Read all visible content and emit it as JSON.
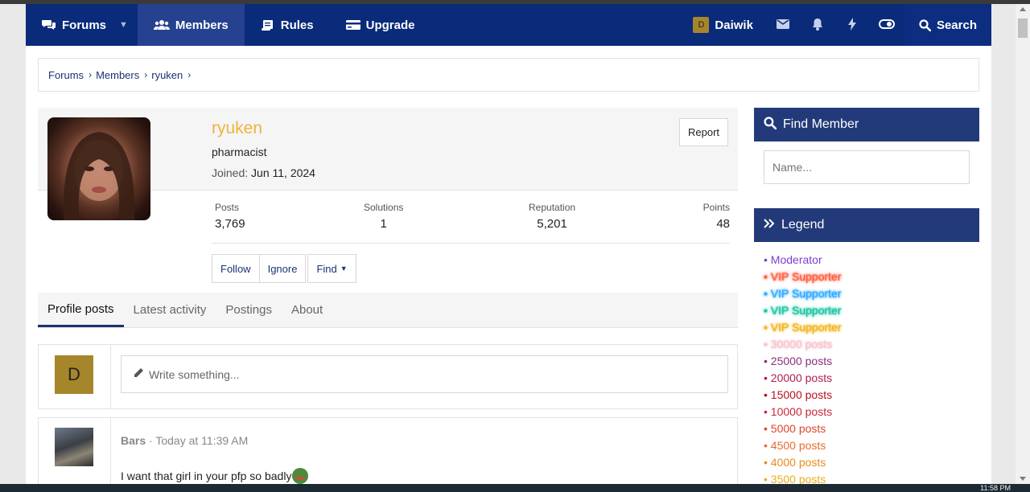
{
  "nav": {
    "items": [
      {
        "label": "Forums",
        "icon": "comments-icon"
      },
      {
        "label": "Members",
        "icon": "users-icon"
      },
      {
        "label": "Rules",
        "icon": "scroll-icon"
      },
      {
        "label": "Upgrade",
        "icon": "card-icon"
      }
    ],
    "user": {
      "initial": "D",
      "name": "Daiwik"
    },
    "search_label": "Search"
  },
  "breadcrumb": [
    "Forums",
    "Members",
    "ryuken"
  ],
  "profile": {
    "username": "ryuken",
    "username_color": "#f0b33c",
    "title": "pharmacist",
    "joined_label": "Joined:",
    "joined_date": "Jun 11, 2024",
    "report_label": "Report",
    "stats": [
      {
        "label": "Posts",
        "value": "3,769"
      },
      {
        "label": "Solutions",
        "value": "1"
      },
      {
        "label": "Reputation",
        "value": "5,201"
      },
      {
        "label": "Points",
        "value": "48"
      }
    ],
    "actions": {
      "follow": "Follow",
      "ignore": "Ignore",
      "find": "Find"
    },
    "tabs": [
      "Profile posts",
      "Latest activity",
      "Postings",
      "About"
    ]
  },
  "compose": {
    "avatar_initial": "D",
    "placeholder": "Write something..."
  },
  "post": {
    "author": "Bars",
    "time": "Today at 11:39 AM",
    "text": "I want that girl in your pfp so badly"
  },
  "sidebar": {
    "find_title": "Find Member",
    "find_placeholder": "Name...",
    "legend_title": "Legend",
    "legend": [
      {
        "label": "Moderator",
        "color": "#7c3fd1"
      },
      {
        "label": "VIP Supporter",
        "color": "#ff5a3c"
      },
      {
        "label": "VIP Supporter",
        "color": "#2aa8ff"
      },
      {
        "label": "VIP Supporter",
        "color": "#19c4a1"
      },
      {
        "label": "VIP Supporter",
        "color": "#f2b41c"
      },
      {
        "label": "30000 posts",
        "color": "#f5c4cc"
      },
      {
        "label": "25000 posts",
        "color": "#8d2f7e"
      },
      {
        "label": "20000 posts",
        "color": "#b01e4f"
      },
      {
        "label": "15000 posts",
        "color": "#b5121b"
      },
      {
        "label": "10000 posts",
        "color": "#c9273a"
      },
      {
        "label": "5000 posts",
        "color": "#e0442a"
      },
      {
        "label": "4500 posts",
        "color": "#ea6a2a"
      },
      {
        "label": "4000 posts",
        "color": "#e98a1c"
      },
      {
        "label": "3500 posts",
        "color": "#e9ad1c"
      }
    ]
  },
  "taskbar": {
    "clock": "11:58 PM"
  }
}
